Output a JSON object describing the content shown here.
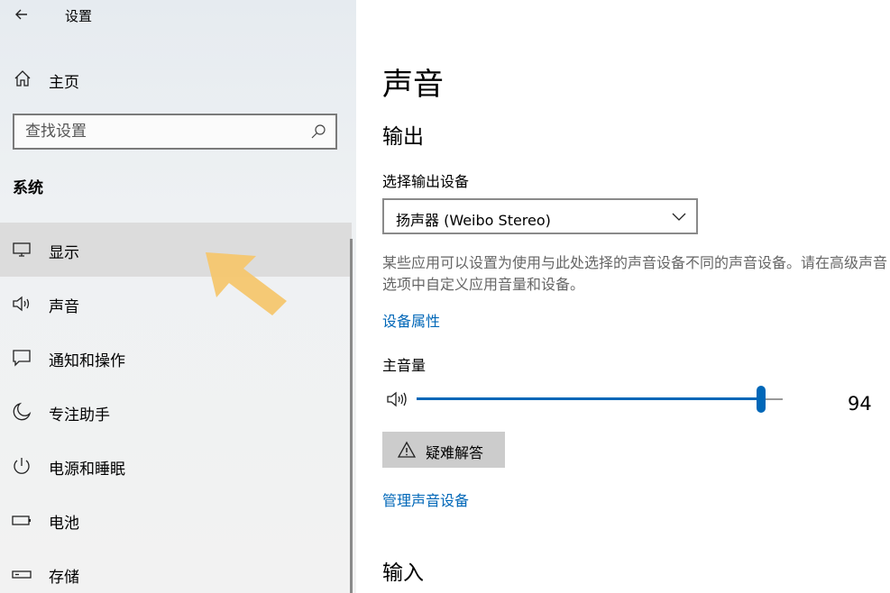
{
  "window": {
    "title": "设置"
  },
  "sidebar": {
    "home_label": "主页",
    "search_placeholder": "查找设置",
    "section_title": "系统",
    "items": [
      {
        "label": "显示",
        "icon": "monitor-icon",
        "selected": true
      },
      {
        "label": "声音",
        "icon": "speaker-icon",
        "selected": false
      },
      {
        "label": "通知和操作",
        "icon": "notification-icon",
        "selected": false
      },
      {
        "label": "专注助手",
        "icon": "moon-icon",
        "selected": false
      },
      {
        "label": "电源和睡眠",
        "icon": "power-icon",
        "selected": false
      },
      {
        "label": "电池",
        "icon": "battery-icon",
        "selected": false
      },
      {
        "label": "存储",
        "icon": "storage-icon",
        "selected": false
      }
    ]
  },
  "main": {
    "title": "声音",
    "output_heading": "输出",
    "output_device_label": "选择输出设备",
    "output_device_value": "扬声器 (Weibo Stereo)",
    "description": "某些应用可以设置为使用与此处选择的声音设备不同的声音设备。请在高级声音选项中自定义应用音量和设备。",
    "device_properties_link": "设备属性",
    "master_volume_label": "主音量",
    "volume": 94,
    "troubleshoot_label": "疑难解答",
    "manage_devices_link": "管理声音设备",
    "input_heading": "输入"
  },
  "colors": {
    "accent": "#0067b8",
    "selected_bg": "#dcdcdc",
    "pointer_arrow": "#f5c56a"
  }
}
